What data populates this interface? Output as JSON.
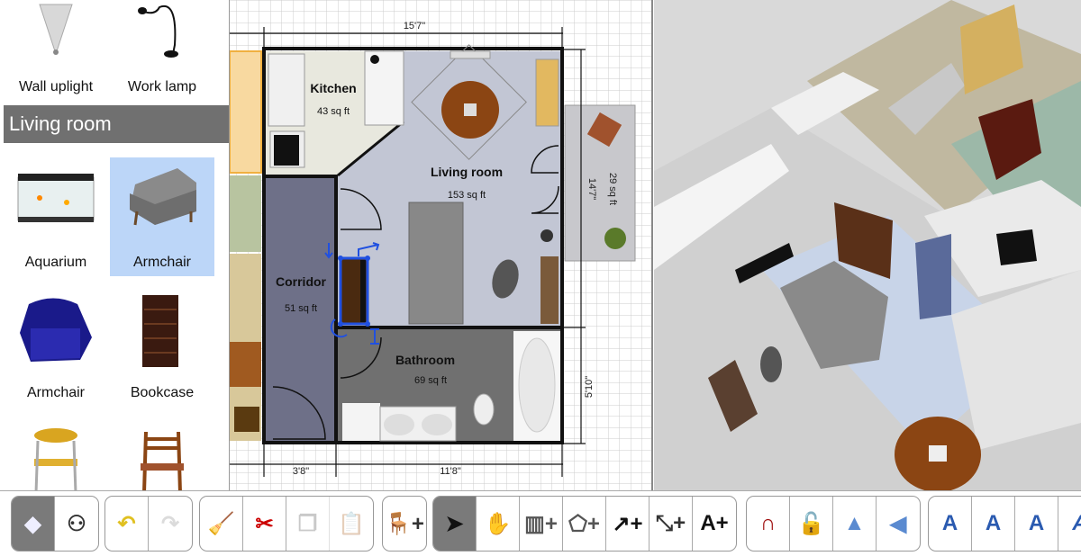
{
  "catalog": {
    "top_items": [
      {
        "label": "Wall uplight"
      },
      {
        "label": "Work lamp"
      }
    ],
    "section_title": "Living room",
    "items": [
      {
        "label": "Aquarium",
        "selected": false
      },
      {
        "label": "Armchair",
        "selected": true
      },
      {
        "label": "Armchair",
        "selected": false
      },
      {
        "label": "Bookcase",
        "selected": false
      }
    ],
    "selected_color": "#bcd6f8"
  },
  "plan": {
    "rooms": [
      {
        "name": "Kitchen",
        "area": "43 sq ft"
      },
      {
        "name": "Living room",
        "area": "153 sq ft"
      },
      {
        "name": "Corridor",
        "area": "51 sq ft"
      },
      {
        "name": "Bathroom",
        "area": "69 sq ft"
      },
      {
        "name": "",
        "area": "29 sq ft"
      }
    ],
    "dimensions": {
      "top": "15'7\"",
      "bottom_left": "3'8\"",
      "bottom_right": "11'8\"",
      "right_upper": "14'7\"",
      "right_lower": "5'10\""
    },
    "selection_color": "#2050e0"
  },
  "toolbar": {
    "groups": [
      [
        {
          "icon": "create-walls-view-icon",
          "active": true
        },
        {
          "icon": "aerial-view-icon"
        }
      ],
      [
        {
          "icon": "undo-icon"
        },
        {
          "icon": "redo-icon",
          "disabled": true
        }
      ],
      [
        {
          "icon": "clean-broom-icon"
        },
        {
          "icon": "cut-icon"
        },
        {
          "icon": "copy-icon",
          "disabled": true
        },
        {
          "icon": "paste-icon",
          "disabled": true
        }
      ],
      [
        {
          "icon": "add-furniture-icon"
        }
      ],
      [
        {
          "icon": "select-arrow-icon",
          "active": true
        },
        {
          "icon": "pan-hand-icon"
        },
        {
          "icon": "create-walls-icon"
        },
        {
          "icon": "create-rooms-icon"
        },
        {
          "icon": "create-polylines-icon"
        },
        {
          "icon": "create-dimensions-icon"
        },
        {
          "icon": "add-text-icon"
        }
      ],
      [
        {
          "icon": "magnetism-icon"
        },
        {
          "icon": "lock-icon"
        },
        {
          "icon": "flip-horizontal-icon"
        },
        {
          "icon": "flip-vertical-icon"
        }
      ],
      [
        {
          "icon": "increase-text-size-icon"
        },
        {
          "icon": "decrease-text-size-icon"
        },
        {
          "icon": "bold-text-icon"
        },
        {
          "icon": "italic-text-icon"
        }
      ]
    ]
  }
}
